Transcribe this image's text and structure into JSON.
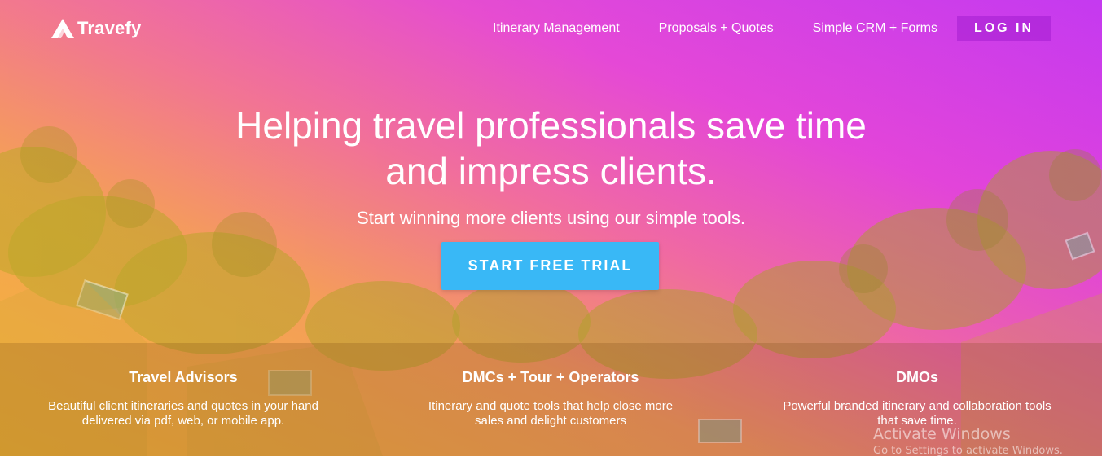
{
  "brand": {
    "name": "Travefy"
  },
  "nav": {
    "links": [
      "Itinerary Management",
      "Proposals + Quotes",
      "Simple CRM + Forms"
    ],
    "login_label": "LOG IN"
  },
  "hero": {
    "headline_line1": "Helping travel professionals save time",
    "headline_line2": "and impress clients.",
    "subhead": "Start winning more clients using our simple tools.",
    "cta_label": "START FREE TRIAL"
  },
  "segments": [
    {
      "title": "Travel Advisors",
      "desc_line1": "Beautiful client itineraries and quotes in your hand",
      "desc_line2": "delivered via pdf, web, or mobile app."
    },
    {
      "title": "DMCs + Tour + Operators",
      "desc_line1": "Itinerary and quote tools that help close more",
      "desc_line2": "sales and delight customers"
    },
    {
      "title": "DMOs",
      "desc_line1": "Powerful branded itinerary and collaboration tools",
      "desc_line2": "that save time."
    }
  ],
  "os_watermark": {
    "line1": "Activate Windows",
    "line2": "Go to Settings to activate Windows."
  },
  "colors": {
    "cta": "#39b8f6",
    "gradient_top_right": "#c43cf0",
    "gradient_bottom_left": "#efb23a",
    "login_bg": "#9614c8"
  },
  "icons": {
    "logo": "travefy-a-mark"
  }
}
